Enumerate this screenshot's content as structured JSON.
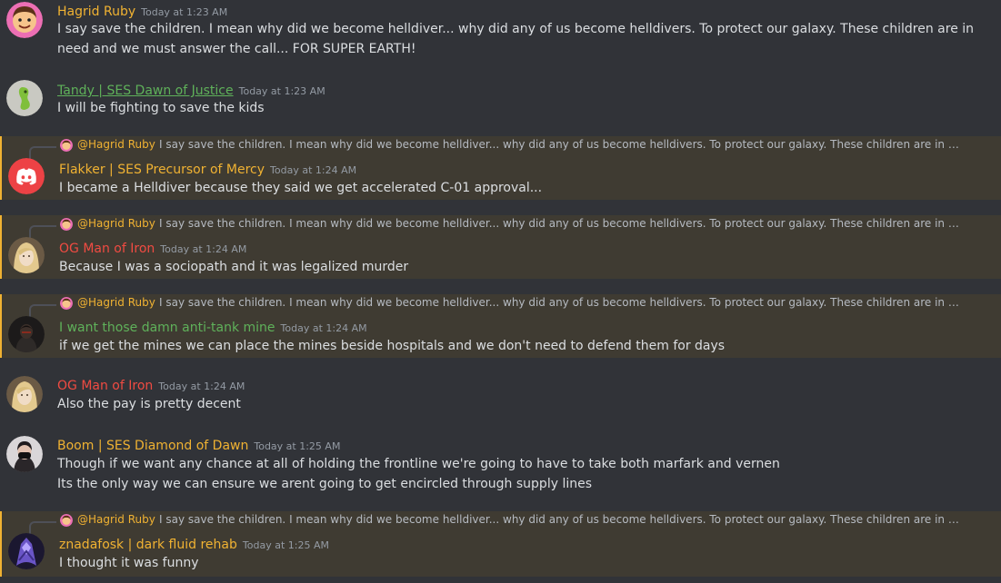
{
  "colors": {
    "background": "#313338",
    "highlight": "#3f3b32",
    "timestamp": "#949ba4",
    "name_yellow": "#f0b232",
    "name_green": "#5fb15a",
    "name_red": "#f04b42"
  },
  "reply": {
    "name": "@Hagrid Ruby",
    "text": "I say save the children. I mean why did we become helldiver... why did any of us become helldivers. To protect our galaxy. These children are in need ..."
  },
  "messages": [
    {
      "author": "Hagrid Ruby",
      "time": "Today at 1:23 AM",
      "avatar": "cartoon-face-avatar",
      "lines": [
        "I say save the children. I mean why did we become helldiver... why did any of us become helldivers. To protect our galaxy. These children are in",
        "need and we must answer the call... FOR SUPER EARTH!"
      ]
    },
    {
      "author": "Tandy | SES Dawn of Justice",
      "time": "Today at 1:23 AM",
      "avatar": "green-creature-avatar",
      "lines": [
        "I will be fighting to save the kids"
      ]
    },
    {
      "author": "Flakker | SES Precursor of Mercy",
      "time": "Today at 1:24 AM",
      "avatar": "discord-logo-avatar",
      "lines": [
        "I became a Helldiver because they said we get accelerated C-01 approval..."
      ]
    },
    {
      "author": "OG Man of Iron",
      "time": "Today at 1:24 AM",
      "avatar": "blonde-portrait-avatar",
      "lines": [
        "Because I was a sociopath and it was legalized murder"
      ]
    },
    {
      "author": "I want those damn anti-tank mine",
      "time": "Today at 1:24 AM",
      "avatar": "dark-figure-avatar",
      "lines": [
        "if we get the mines we can place the mines beside hospitals and we don't need to defend them for days"
      ]
    },
    {
      "author": "OG Man of Iron",
      "time": "Today at 1:24 AM",
      "avatar": "blonde-portrait-avatar",
      "lines": [
        "Also the pay is pretty decent"
      ]
    },
    {
      "author": "Boom | SES Diamond of Dawn",
      "time": "Today at 1:25 AM",
      "avatar": "masked-person-avatar",
      "lines": [
        "Though if we want any chance at all of holding the frontline we're going to have to take both marfark and vernen",
        "Its the only way we can ensure we arent going to get encircled through supply lines"
      ]
    },
    {
      "author": "znadafosk | dark fluid rehab",
      "time": "Today at 1:25 AM",
      "avatar": "purple-armor-avatar",
      "lines": [
        "I thought it was funny"
      ]
    }
  ]
}
